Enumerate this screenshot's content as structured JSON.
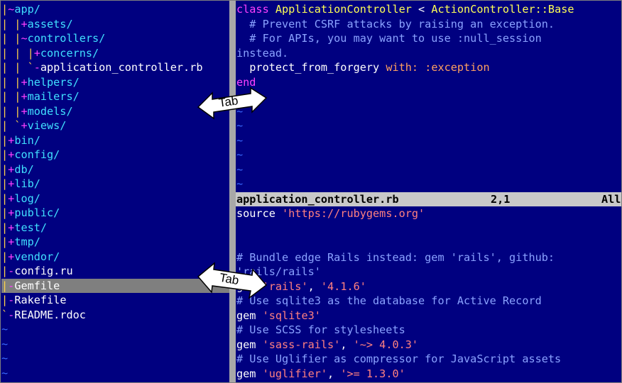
{
  "tree": {
    "lines": [
      {
        "pipe": "|",
        "mark": "~",
        "name": "app/",
        "kind": "dir"
      },
      {
        "pipe": "| |",
        "mark": "+",
        "name": "assets/",
        "kind": "dir"
      },
      {
        "pipe": "| |",
        "mark": "~",
        "name": "controllers/",
        "kind": "dir"
      },
      {
        "pipe": "| | |",
        "mark": "+",
        "name": "concerns/",
        "kind": "dir"
      },
      {
        "pipe": "| | `",
        "mark": "-",
        "name": "application_controller.rb",
        "kind": "file"
      },
      {
        "pipe": "| |",
        "mark": "+",
        "name": "helpers/",
        "kind": "dir"
      },
      {
        "pipe": "| |",
        "mark": "+",
        "name": "mailers/",
        "kind": "dir"
      },
      {
        "pipe": "| |",
        "mark": "+",
        "name": "models/",
        "kind": "dir"
      },
      {
        "pipe": "| `",
        "mark": "+",
        "name": "views/",
        "kind": "dir"
      },
      {
        "pipe": "|",
        "mark": "+",
        "name": "bin/",
        "kind": "dir"
      },
      {
        "pipe": "|",
        "mark": "+",
        "name": "config/",
        "kind": "dir"
      },
      {
        "pipe": "|",
        "mark": "+",
        "name": "db/",
        "kind": "dir"
      },
      {
        "pipe": "|",
        "mark": "+",
        "name": "lib/",
        "kind": "dir"
      },
      {
        "pipe": "|",
        "mark": "+",
        "name": "log/",
        "kind": "dir"
      },
      {
        "pipe": "|",
        "mark": "+",
        "name": "public/",
        "kind": "dir"
      },
      {
        "pipe": "|",
        "mark": "+",
        "name": "test/",
        "kind": "dir"
      },
      {
        "pipe": "|",
        "mark": "+",
        "name": "tmp/",
        "kind": "dir"
      },
      {
        "pipe": "|",
        "mark": "+",
        "name": "vendor/",
        "kind": "dir"
      },
      {
        "pipe": "|",
        "mark": "-",
        "name": "config.ru",
        "kind": "file"
      },
      {
        "pipe": "|",
        "mark": "-",
        "name": "Gemfile",
        "kind": "file",
        "selected": true
      },
      {
        "pipe": "|",
        "mark": "-",
        "name": "Rakefile",
        "kind": "file"
      },
      {
        "pipe": "`",
        "mark": "-",
        "name": "README.rdoc",
        "kind": "file"
      },
      {
        "tilde": "~"
      },
      {
        "tilde": "~"
      },
      {
        "tilde": "~"
      },
      {
        "tilde": "~"
      }
    ]
  },
  "top_pane": {
    "lines": [
      [
        {
          "t": "class ",
          "c": "kw"
        },
        {
          "t": "ApplicationController",
          "c": "cls"
        },
        {
          "t": " < ",
          "c": "pl"
        },
        {
          "t": "ActionController::Base",
          "c": "cls"
        }
      ],
      [
        {
          "t": "  # Prevent CSRF attacks by raising an exception.",
          "c": "cm"
        }
      ],
      [
        {
          "t": "  # For APIs, you may want to use :null_session",
          "c": "cm"
        }
      ],
      [
        {
          "t": "instead.",
          "c": "cm"
        }
      ],
      [
        {
          "t": "  protect_from_forgery ",
          "c": "pl"
        },
        {
          "t": "with:",
          "c": "sym"
        },
        {
          "t": " ",
          "c": "pl"
        },
        {
          "t": ":exception",
          "c": "sym"
        }
      ],
      [
        {
          "t": "end",
          "c": "kw"
        }
      ],
      [
        {
          "t": "~",
          "c": "tilde"
        }
      ],
      [
        {
          "t": "~",
          "c": "tilde"
        }
      ],
      [
        {
          "t": "~",
          "c": "tilde"
        }
      ],
      [
        {
          "t": "~",
          "c": "tilde"
        }
      ],
      [
        {
          "t": "~",
          "c": "tilde"
        }
      ],
      [
        {
          "t": "~",
          "c": "tilde"
        }
      ],
      [
        {
          "t": "~",
          "c": "tilde"
        }
      ]
    ]
  },
  "status_bar": {
    "filename": "application_controller.rb",
    "position": "2,1",
    "scroll": "All"
  },
  "bottom_pane": {
    "lines": [
      [
        {
          "t": "source ",
          "c": "gm"
        },
        {
          "t": "'https://rubygems.org'",
          "c": "str"
        }
      ],
      [
        {
          "t": "",
          "c": "pl"
        }
      ],
      [
        {
          "t": "",
          "c": "pl"
        }
      ],
      [
        {
          "t": "# Bundle edge Rails instead: gem 'rails', github:",
          "c": "cm"
        }
      ],
      [
        {
          "t": "'rails/rails'",
          "c": "cm"
        }
      ],
      [
        {
          "t": "gem ",
          "c": "gm"
        },
        {
          "t": "'rails'",
          "c": "str"
        },
        {
          "t": ", ",
          "c": "gm"
        },
        {
          "t": "'4.1.6'",
          "c": "str"
        }
      ],
      [
        {
          "t": "# Use sqlite3 as the database for Active Record",
          "c": "cm"
        }
      ],
      [
        {
          "t": "gem ",
          "c": "gm"
        },
        {
          "t": "'sqlite3'",
          "c": "str"
        }
      ],
      [
        {
          "t": "# Use SCSS for stylesheets",
          "c": "cm"
        }
      ],
      [
        {
          "t": "gem ",
          "c": "gm"
        },
        {
          "t": "'sass-rails'",
          "c": "str"
        },
        {
          "t": ", ",
          "c": "gm"
        },
        {
          "t": "'~> 4.0.3'",
          "c": "str"
        }
      ],
      [
        {
          "t": "# Use Uglifier as compressor for JavaScript assets",
          "c": "cm"
        }
      ],
      [
        {
          "t": "gem ",
          "c": "gm"
        },
        {
          "t": "'uglifier'",
          "c": "str"
        },
        {
          "t": ", ",
          "c": "gm"
        },
        {
          "t": "'>= 1.3.0'",
          "c": "str"
        }
      ]
    ]
  },
  "callouts": {
    "tab_top": "Tab",
    "tab_bottom": "Tab"
  },
  "colors": {
    "background": "#000080",
    "selection": "#7f7f7f",
    "statusbar": "#c9c9c9",
    "tree_pipe": "#ffd24a",
    "tree_mark": "#ff40ff",
    "tree_dir": "#40e0ff",
    "comment": "#8aa2ff",
    "string": "#ff8080",
    "class_name": "#ffff55"
  }
}
